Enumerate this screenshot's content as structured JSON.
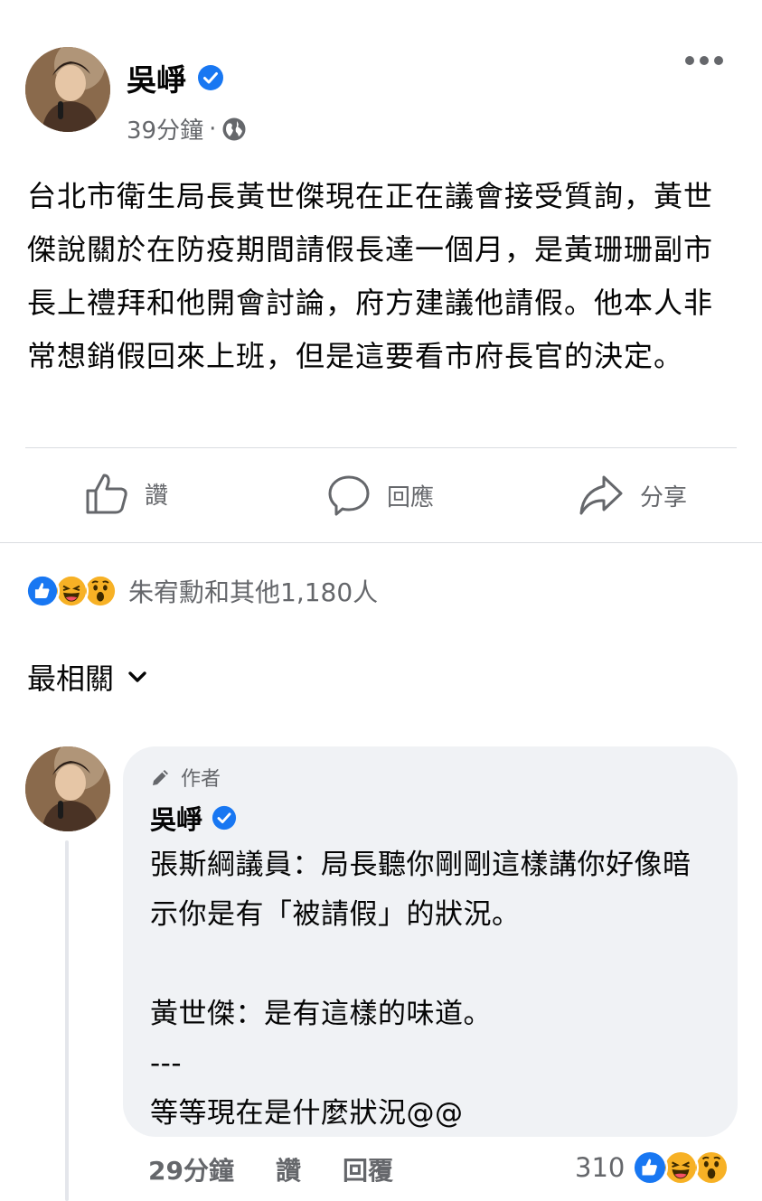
{
  "post": {
    "author": "吳崢",
    "time": "39分鐘",
    "separator": "·",
    "text": "台北市衛生局長黃世傑現在正在議會接受質詢，黃世傑說關於在防疫期間請假長達一個月，是黃珊珊副市長上禮拜和他開會討論，府方建議他請假。他本人非常想銷假回來上班，但是這要看市府長官的決定。"
  },
  "actions": {
    "like": "讚",
    "comment": "回應",
    "share": "分享"
  },
  "reactions": {
    "summary": "朱宥勳和其他1,180人"
  },
  "sort": {
    "label": "最相關"
  },
  "comment": {
    "badge": "作者",
    "author": "吳崢",
    "text": "張斯綱議員：局長聽你剛剛這樣講你好像暗示你是有「被請假」的狀況。\n\n黃世傑：是有這樣的味道。\n---\n等等現在是什麼狀況@@",
    "time": "29分鐘",
    "like": "讚",
    "reply": "回覆",
    "reaction_count": "310"
  },
  "colors": {
    "facebook_blue": "#1877f2",
    "secondary_text": "#65676b",
    "bubble_bg": "#f0f2f5"
  }
}
